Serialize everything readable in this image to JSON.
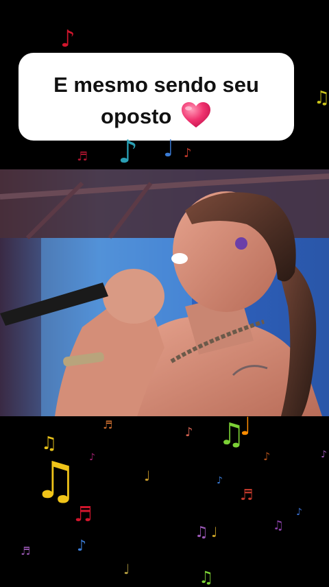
{
  "caption": {
    "line1": "E mesmo sendo seu",
    "line2": "oposto",
    "emoji": "heart-icon"
  },
  "video": {
    "subject": "singer-with-microphone"
  },
  "decorations": {
    "glyph_note": "♪",
    "glyph_beamed": "♫",
    "glyph_eighth": "♬",
    "glyph_quarter": "♩",
    "colors": [
      "#e01530",
      "#f0c419",
      "#2bb0c6",
      "#9b59b6",
      "#3a7bd5",
      "#7cd136",
      "#ff8c00"
    ]
  }
}
